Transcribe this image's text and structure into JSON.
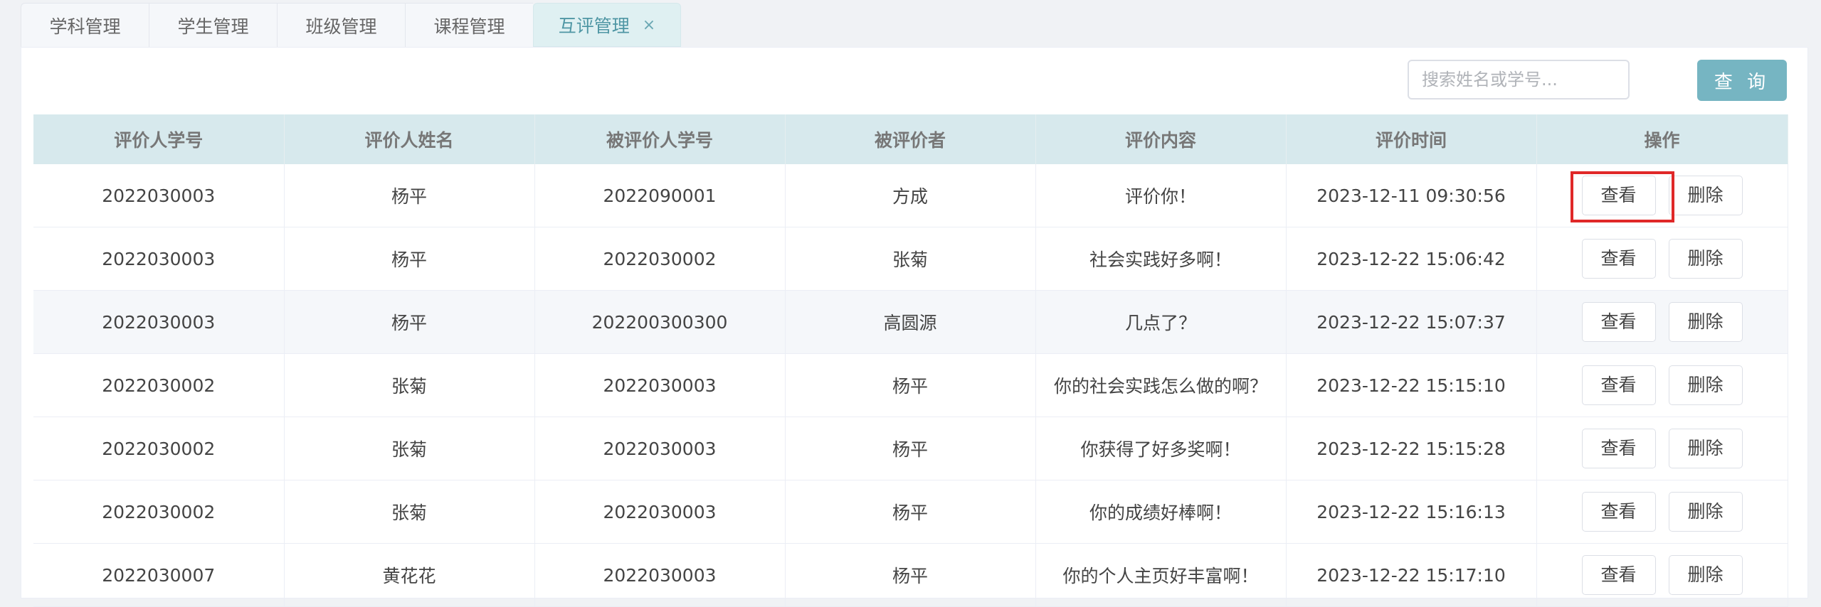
{
  "tabs": [
    {
      "label": "学科管理"
    },
    {
      "label": "学生管理"
    },
    {
      "label": "班级管理"
    },
    {
      "label": "课程管理"
    },
    {
      "label": "互评管理",
      "active": true
    }
  ],
  "tab_close_glyph": "×",
  "search": {
    "placeholder": "搜索姓名或学号...",
    "value": "",
    "button_label": "查 询"
  },
  "table": {
    "headers": [
      "评价人学号",
      "评价人姓名",
      "被评价人学号",
      "被评价者",
      "评价内容",
      "评价时间",
      "操作"
    ],
    "rows": [
      {
        "evaluator_id": "2022030003",
        "evaluator_name": "杨平",
        "target_id": "2022090001",
        "target_name": "方成",
        "content": "评价你！",
        "time": "2023-12-11 09:30:56"
      },
      {
        "evaluator_id": "2022030003",
        "evaluator_name": "杨平",
        "target_id": "2022030002",
        "target_name": "张菊",
        "content": "社会实践好多啊！",
        "time": "2023-12-22 15:06:42"
      },
      {
        "evaluator_id": "2022030003",
        "evaluator_name": "杨平",
        "target_id": "202200300300",
        "target_name": "高圆源",
        "content": "几点了？",
        "time": "2023-12-22 15:07:37"
      },
      {
        "evaluator_id": "2022030002",
        "evaluator_name": "张菊",
        "target_id": "2022030003",
        "target_name": "杨平",
        "content": "你的社会实践怎么做的啊？",
        "time": "2023-12-22 15:15:10"
      },
      {
        "evaluator_id": "2022030002",
        "evaluator_name": "张菊",
        "target_id": "2022030003",
        "target_name": "杨平",
        "content": "你获得了好多奖啊！",
        "time": "2023-12-22 15:15:28"
      },
      {
        "evaluator_id": "2022030002",
        "evaluator_name": "张菊",
        "target_id": "2022030003",
        "target_name": "杨平",
        "content": "你的成绩好棒啊！",
        "time": "2023-12-22 15:16:13"
      },
      {
        "evaluator_id": "2022030007",
        "evaluator_name": "黄花花",
        "target_id": "2022030003",
        "target_name": "杨平",
        "content": "你的个人主页好丰富啊！",
        "time": "2023-12-22 15:17:10"
      }
    ],
    "view_label": "查看",
    "delete_label": "删除"
  },
  "colors": {
    "accent": "#76b5c2",
    "header_bg": "#d7e9ed",
    "highlight": "#e02828"
  }
}
